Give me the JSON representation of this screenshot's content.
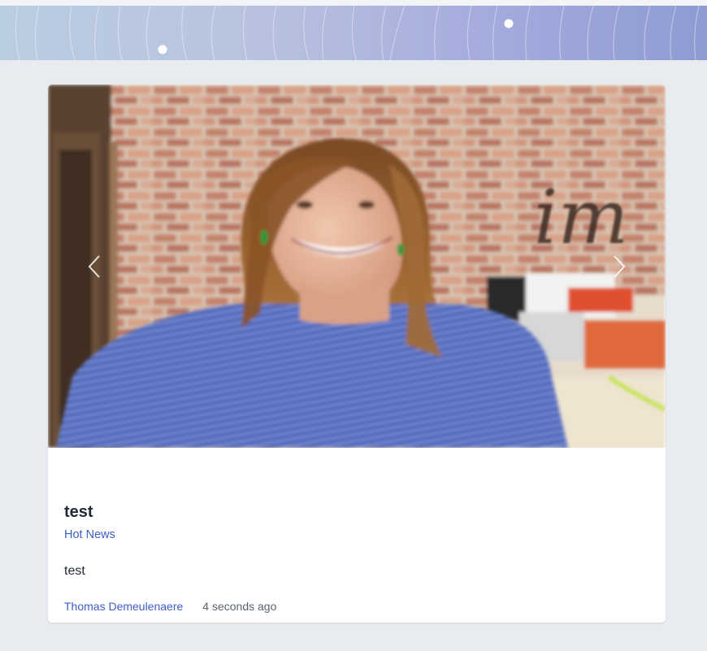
{
  "header": {
    "gradient_colors": [
      "#b9cde0",
      "#b9c3df",
      "#a7aede",
      "#8e9bd2"
    ]
  },
  "carousel": {
    "prev_icon": "chevron-left-icon",
    "next_icon": "chevron-right-icon",
    "image_text": "im"
  },
  "post": {
    "title": "test",
    "category": "Hot News",
    "content": "test",
    "author": "Thomas Demeulenaere",
    "time": "4 seconds ago"
  },
  "colors": {
    "background": "#e8ebf0",
    "link": "#3d5ec4",
    "text": "#1f2937",
    "muted": "#5b6270"
  }
}
